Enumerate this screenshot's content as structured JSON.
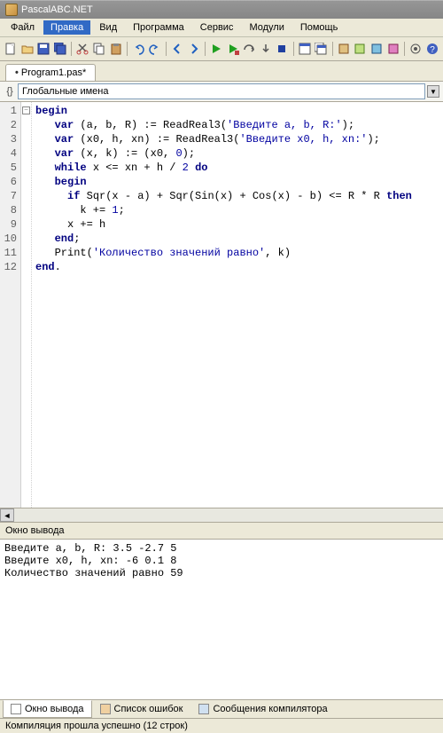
{
  "window": {
    "title": "PascalABC.NET"
  },
  "menu": {
    "items": [
      "Файл",
      "Правка",
      "Вид",
      "Программа",
      "Сервис",
      "Модули",
      "Помощь"
    ],
    "active_index": 1
  },
  "tab": {
    "label": "Program1.pas*"
  },
  "namespace": {
    "label": "Глобальные имена"
  },
  "code": {
    "lines": [
      {
        "n": "1",
        "text_parts": [
          {
            "t": "begin",
            "c": "kw"
          }
        ]
      },
      {
        "n": "2",
        "text_parts": [
          {
            "t": "   "
          },
          {
            "t": "var",
            "c": "kw"
          },
          {
            "t": " (a, b, R) := ReadReal3("
          },
          {
            "t": "'Введите a, b, R:'",
            "c": "str"
          },
          {
            "t": ");"
          }
        ]
      },
      {
        "n": "3",
        "text_parts": [
          {
            "t": "   "
          },
          {
            "t": "var",
            "c": "kw"
          },
          {
            "t": " (x0, h, xn) := ReadReal3("
          },
          {
            "t": "'Введите x0, h, xn:'",
            "c": "str"
          },
          {
            "t": ");"
          }
        ]
      },
      {
        "n": "4",
        "text_parts": [
          {
            "t": "   "
          },
          {
            "t": "var",
            "c": "kw"
          },
          {
            "t": " (x, k) := (x0, "
          },
          {
            "t": "0",
            "c": "num"
          },
          {
            "t": ");"
          }
        ]
      },
      {
        "n": "5",
        "text_parts": [
          {
            "t": "   "
          },
          {
            "t": "while",
            "c": "kw"
          },
          {
            "t": " x <= xn + h / "
          },
          {
            "t": "2",
            "c": "num"
          },
          {
            "t": " "
          },
          {
            "t": "do",
            "c": "kw"
          }
        ]
      },
      {
        "n": "6",
        "text_parts": [
          {
            "t": "   "
          },
          {
            "t": "begin",
            "c": "kw"
          }
        ]
      },
      {
        "n": "7",
        "text_parts": [
          {
            "t": "     "
          },
          {
            "t": "if",
            "c": "kw"
          },
          {
            "t": " Sqr(x - a) + Sqr(Sin(x) + Cos(x) - b) <= R * R "
          },
          {
            "t": "then",
            "c": "kw"
          }
        ]
      },
      {
        "n": "8",
        "text_parts": [
          {
            "t": "       k += "
          },
          {
            "t": "1",
            "c": "num"
          },
          {
            "t": ";"
          }
        ]
      },
      {
        "n": "9",
        "text_parts": [
          {
            "t": "     x += h"
          }
        ]
      },
      {
        "n": "10",
        "text_parts": [
          {
            "t": "   "
          },
          {
            "t": "end",
            "c": "kw"
          },
          {
            "t": ";"
          }
        ]
      },
      {
        "n": "11",
        "text_parts": [
          {
            "t": "   Print("
          },
          {
            "t": "'Количество значений равно'",
            "c": "str"
          },
          {
            "t": ", k)"
          }
        ]
      },
      {
        "n": "12",
        "text_parts": [
          {
            "t": "end",
            "c": "kw"
          },
          {
            "t": "."
          }
        ]
      }
    ]
  },
  "output": {
    "header": "Окно вывода",
    "text": "Введите a, b, R: 3.5 -2.7 5\nВведите x0, h, xn: -6 0.1 8\nКоличество значений равно 59 "
  },
  "bottom_tabs": {
    "items": [
      "Окно вывода",
      "Список ошибок",
      "Сообщения компилятора"
    ],
    "active_index": 0
  },
  "status": {
    "text": "Компиляция прошла успешно (12 строк)"
  },
  "toolbar_icons": [
    "new-file-icon",
    "open-icon",
    "save-icon",
    "save-all-icon",
    "sep",
    "cut-icon",
    "copy-icon",
    "paste-icon",
    "sep",
    "undo-icon",
    "redo-icon",
    "sep",
    "back-icon",
    "forward-icon",
    "sep",
    "run-icon",
    "run-noデバッグ-icon",
    "step-over-icon",
    "step-into-icon",
    "stop-icon",
    "sep",
    "form-icon",
    "form2-icon",
    "sep",
    "module1-icon",
    "module2-icon",
    "module3-icon",
    "module4-icon",
    "sep",
    "options-icon",
    "help-icon"
  ]
}
